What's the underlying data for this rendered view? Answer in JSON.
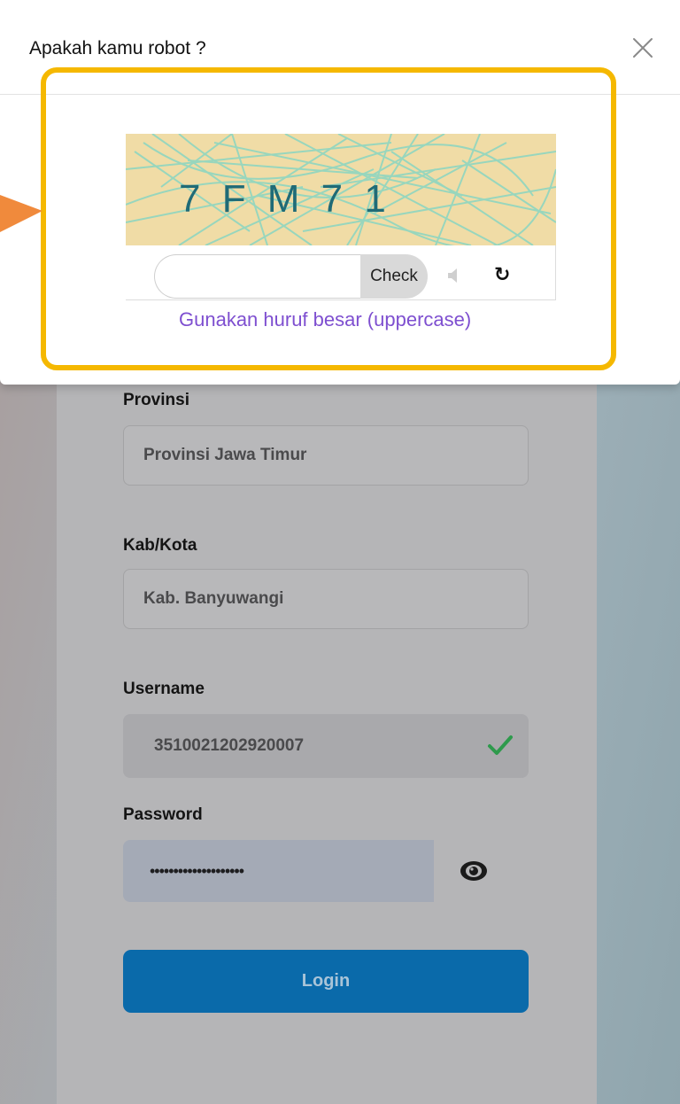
{
  "modal": {
    "title": "Apakah kamu robot ?",
    "captcha_text": "7 F M 7 1",
    "check_label": "Check",
    "input_value": "",
    "hint": "Gunakan huruf besar (uppercase)",
    "refresh_glyph": "↻",
    "highlight_color": "#f5b800",
    "arrow_color": "#f08a3c"
  },
  "form": {
    "provinsi_label": "Provinsi",
    "provinsi_value": "Provinsi Jawa Timur",
    "kabkota_label": "Kab/Kota",
    "kabkota_value": "Kab. Banyuwangi",
    "username_label": "Username",
    "username_value": "3510021202920007",
    "password_label": "Password",
    "password_value": "••••••••••••••••••••",
    "login_label": "Login",
    "login_color": "#0a6aaa"
  },
  "icons": {
    "close": "close-icon",
    "speaker": "speaker-icon",
    "refresh": "refresh-icon",
    "check": "check-icon",
    "eye": "eye-icon"
  }
}
